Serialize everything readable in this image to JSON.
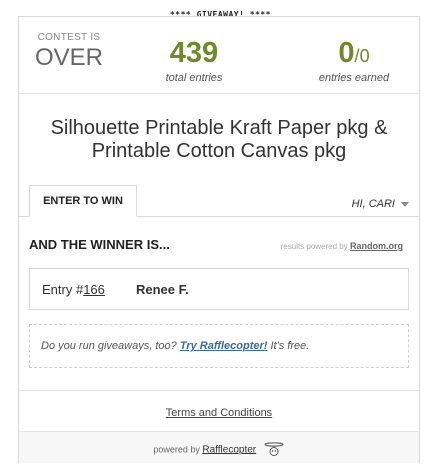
{
  "banner": "**** GIVEAWAY! ****",
  "stats": {
    "contest_line1": "CONTEST IS",
    "contest_line2": "OVER",
    "total_entries": "439",
    "total_label": "total entries",
    "earned_value": "0",
    "earned_slash": "/",
    "earned_total": "0",
    "earned_label": "entries earned"
  },
  "giveaway_title": "Silhouette Printable Kraft Paper pkg & Printable Cotton Canvas pkg",
  "tabs": {
    "enter_label": "ENTER TO WIN",
    "user_label": "HI, CARI"
  },
  "winner": {
    "heading": "AND THE WINNER IS...",
    "powered_text": "results powered by",
    "powered_link": "Random.org",
    "entry_prefix": "Entry #",
    "entry_number": "166",
    "winner_name": "Renee F."
  },
  "promo": {
    "text_before": "Do you run giveaways, too?",
    "link": "Try Rafflecopter!",
    "text_after": "It's free."
  },
  "terms_label": "Terms and Conditions",
  "footer": {
    "powered_by": "powered by",
    "brand": "Rafflecopter"
  },
  "colors": {
    "accent_green": "#6e8a2b",
    "link_blue": "#3a6aa0"
  }
}
